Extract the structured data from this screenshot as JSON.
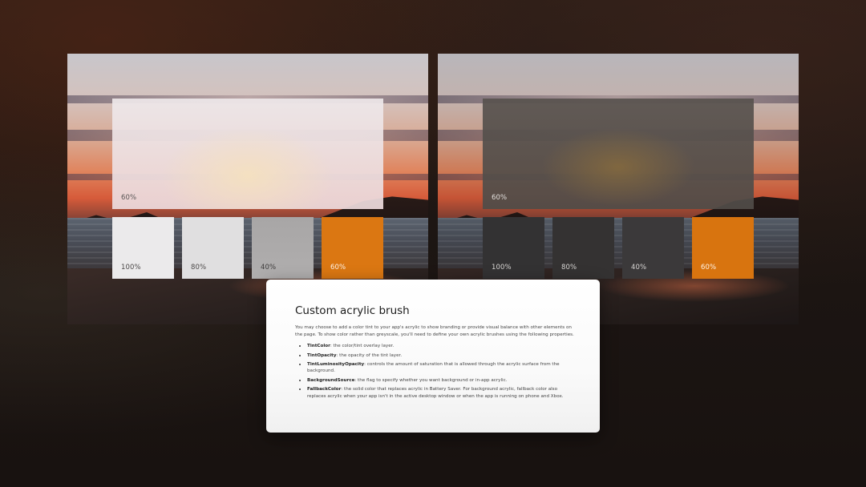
{
  "left_panel": {
    "big_label": "60%",
    "swatches": [
      "100%",
      "80%",
      "40%",
      "60%"
    ]
  },
  "right_panel": {
    "big_label": "60%",
    "swatches": [
      "100%",
      "80%",
      "40%",
      "60%"
    ]
  },
  "card": {
    "title": "Custom acrylic brush",
    "intro": "You may choose to add a color tint to your app's acrylic to show branding or provide visual balance with other elements on the page. To show color rather than greyscale, you'll need to define your own acrylic brushes using the following properties.",
    "items": [
      {
        "term": "TintColor",
        "desc": ": the color/tint overlay layer."
      },
      {
        "term": "TintOpacity",
        "desc": ": the opacity of the tint layer."
      },
      {
        "term": "TintLuminosityOpacity",
        "desc": ": controls the amount of saturation that is allowed through the acrylic surface from the background."
      },
      {
        "term": "BackgroundSource",
        "desc": ": the flag to specify whether you want background or in-app acrylic."
      },
      {
        "term": "FallbackColor",
        "desc": ": the solid color that replaces acrylic in Battery Saver. For background acrylic, fallback color also replaces acrylic when your app isn't in the active desktop window or when the app is running on phone and Xbox."
      }
    ]
  },
  "colors": {
    "accent_orange": "#db7712",
    "light_tint": "#ebeaeb",
    "dark_tint": "#333233"
  }
}
